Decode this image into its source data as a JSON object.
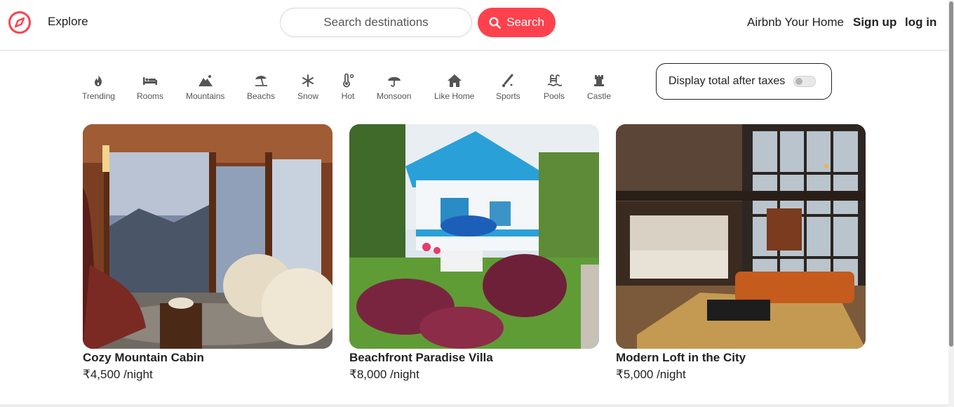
{
  "nav": {
    "explore_label": "Explore",
    "search_placeholder": "Search destinations",
    "search_button": "Search",
    "host_link": "Airbnb Your Home",
    "signup_link": "Sign up",
    "login_link": "log in"
  },
  "filters": [
    {
      "label": "Trending",
      "icon": "fire-icon"
    },
    {
      "label": "Rooms",
      "icon": "bed-icon"
    },
    {
      "label": "Mountains",
      "icon": "mountain-icon"
    },
    {
      "label": "Beachs",
      "icon": "umbrella-beach-icon"
    },
    {
      "label": "Snow",
      "icon": "snowflake-icon"
    },
    {
      "label": "Hot",
      "icon": "thermometer-icon"
    },
    {
      "label": "Monsoon",
      "icon": "umbrella-icon"
    },
    {
      "label": "Like Home",
      "icon": "house-icon"
    },
    {
      "label": "Sports",
      "icon": "sports-icon"
    },
    {
      "label": "Pools",
      "icon": "pool-icon"
    },
    {
      "label": "Castle",
      "icon": "castle-icon"
    }
  ],
  "tax_toggle": {
    "label": "Display total after taxes",
    "enabled": false
  },
  "listings": [
    {
      "title": "Cozy Mountain Cabin",
      "price": "₹4,500 /night"
    },
    {
      "title": "Beachfront Paradise Villa",
      "price": "₹8,000 /night"
    },
    {
      "title": "Modern Loft in the City",
      "price": "₹5,000 /night"
    }
  ],
  "colors": {
    "brand": "#fe424d",
    "text": "#222222",
    "muted": "#555555"
  }
}
